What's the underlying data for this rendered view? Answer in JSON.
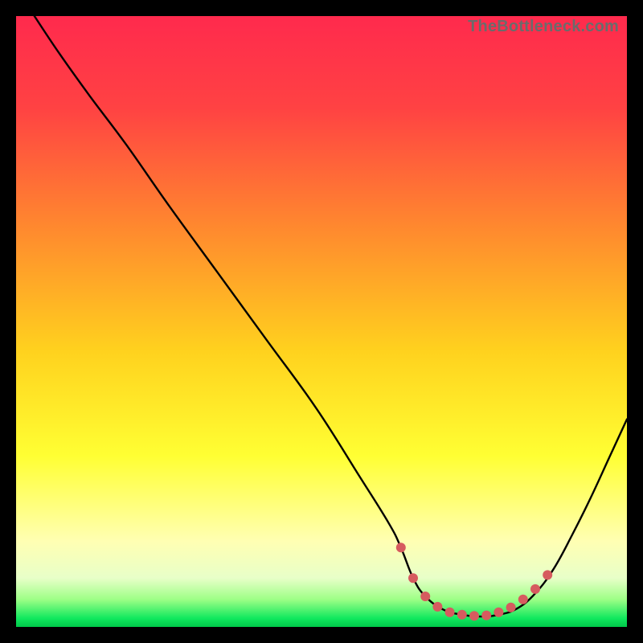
{
  "watermark": "TheBottleneck.com",
  "chart_data": {
    "type": "line",
    "title": "",
    "xlabel": "",
    "ylabel": "",
    "xlim": [
      0,
      100
    ],
    "ylim": [
      0,
      100
    ],
    "grid": false,
    "legend": false,
    "gradient_stops": [
      {
        "offset": 0.0,
        "color": "#ff2a4d"
      },
      {
        "offset": 0.15,
        "color": "#ff4243"
      },
      {
        "offset": 0.35,
        "color": "#ff8a2e"
      },
      {
        "offset": 0.55,
        "color": "#ffd21e"
      },
      {
        "offset": 0.72,
        "color": "#ffff33"
      },
      {
        "offset": 0.86,
        "color": "#ffffb3"
      },
      {
        "offset": 0.92,
        "color": "#e8ffc8"
      },
      {
        "offset": 0.955,
        "color": "#9dff86"
      },
      {
        "offset": 0.986,
        "color": "#10e85e"
      },
      {
        "offset": 1.0,
        "color": "#00c74a"
      }
    ],
    "series": [
      {
        "name": "curve",
        "comment": "y as percent of plot height (0=top, 100=bottom); x percent 0..100",
        "points": [
          {
            "x": 3,
            "y": 0
          },
          {
            "x": 7,
            "y": 6
          },
          {
            "x": 12,
            "y": 13
          },
          {
            "x": 18,
            "y": 21
          },
          {
            "x": 25,
            "y": 31
          },
          {
            "x": 33,
            "y": 42
          },
          {
            "x": 41,
            "y": 53
          },
          {
            "x": 49,
            "y": 64
          },
          {
            "x": 56,
            "y": 75
          },
          {
            "x": 61,
            "y": 83
          },
          {
            "x": 63,
            "y": 87
          },
          {
            "x": 65,
            "y": 92
          },
          {
            "x": 67,
            "y": 95
          },
          {
            "x": 70,
            "y": 97.2
          },
          {
            "x": 73,
            "y": 98.0
          },
          {
            "x": 76,
            "y": 98.3
          },
          {
            "x": 79,
            "y": 98.0
          },
          {
            "x": 82,
            "y": 97.0
          },
          {
            "x": 85,
            "y": 94.5
          },
          {
            "x": 88,
            "y": 90.5
          },
          {
            "x": 91,
            "y": 85
          },
          {
            "x": 94,
            "y": 79
          },
          {
            "x": 97,
            "y": 72.5
          },
          {
            "x": 100,
            "y": 66
          }
        ]
      },
      {
        "name": "dots",
        "comment": "salmon-colored markers along the valley",
        "color": "#d65b5f",
        "radius": 6,
        "points": [
          {
            "x": 63,
            "y": 87
          },
          {
            "x": 65,
            "y": 92
          },
          {
            "x": 67,
            "y": 95
          },
          {
            "x": 69,
            "y": 96.7
          },
          {
            "x": 71,
            "y": 97.6
          },
          {
            "x": 73,
            "y": 98.0
          },
          {
            "x": 75,
            "y": 98.2
          },
          {
            "x": 77,
            "y": 98.1
          },
          {
            "x": 79,
            "y": 97.6
          },
          {
            "x": 81,
            "y": 96.8
          },
          {
            "x": 83,
            "y": 95.5
          },
          {
            "x": 85,
            "y": 93.8
          },
          {
            "x": 87,
            "y": 91.5
          }
        ]
      }
    ]
  }
}
